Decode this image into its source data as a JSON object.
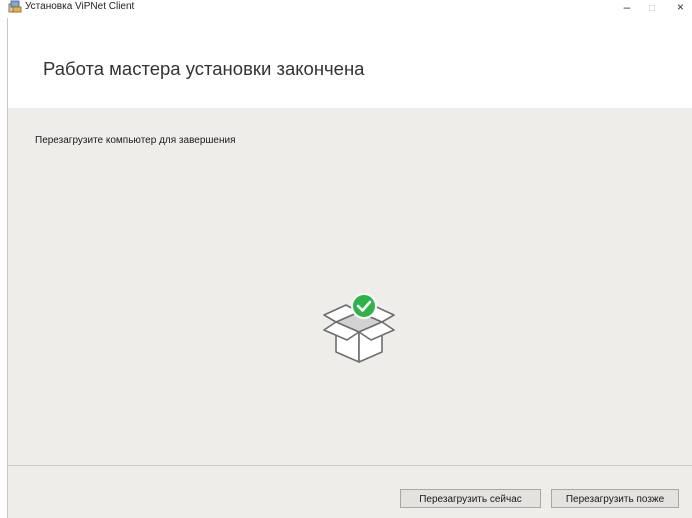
{
  "window": {
    "title": "Установка ViPNet Client",
    "controls": {
      "minimize": "–",
      "maximize": "□",
      "close": "×"
    }
  },
  "header": {
    "title": "Работа мастера установки закончена"
  },
  "content": {
    "message": "Перезагрузите компьютер для завершения",
    "illustration_icon": "open-box-checkmark-icon",
    "accent_color": "#2db34a"
  },
  "footer": {
    "restart_now_label": "Перезагрузить сейчас",
    "restart_later_label": "Перезагрузить позже"
  }
}
